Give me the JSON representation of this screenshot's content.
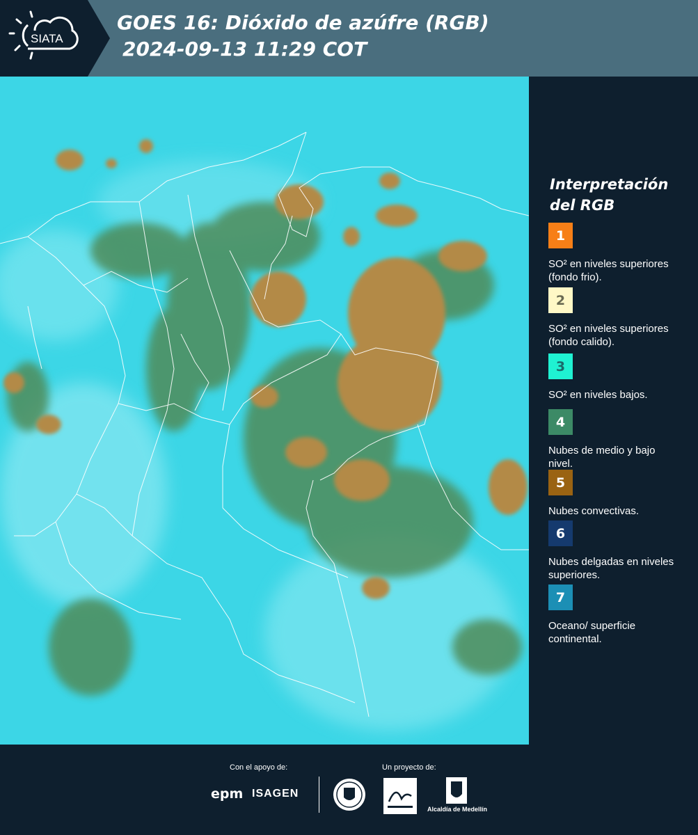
{
  "header": {
    "logo_text": "SIATA",
    "title_line1": "GOES 16: Dióxido de azúfre (RGB)",
    "title_line2": "2024-09-13 11:29 COT"
  },
  "legend": {
    "title_line1": "Interpretación",
    "title_line2": "del RGB",
    "items": [
      {
        "num": "1",
        "color": "#f77f17",
        "num_color": "#ffffff",
        "text": "SO² en niveles superiores (fondo frio)."
      },
      {
        "num": "2",
        "color": "#fff8c6",
        "num_color": "#6a6a52",
        "text": "SO² en niveles superiores (fondo calido)."
      },
      {
        "num": "3",
        "color": "#1ff2d2",
        "num_color": "#1a6a6a",
        "text": "SO² en niveles bajos."
      },
      {
        "num": "4",
        "color": "#3c8a66",
        "num_color": "#ffffff",
        "text": "Nubes de medio y bajo nivel."
      },
      {
        "num": "5",
        "color": "#9a6312",
        "num_color": "#ffffff",
        "text": "Nubes convectivas."
      },
      {
        "num": "6",
        "color": "#153a6e",
        "num_color": "#ffffff",
        "text": "Nubes delgadas en niveles superiores."
      },
      {
        "num": "7",
        "color": "#1c8fb5",
        "num_color": "#ffffff",
        "text": "Oceano/ superficie continental."
      }
    ]
  },
  "footer": {
    "support_label": "Con el apoyo de:",
    "project_label": "Un proyecto de:",
    "epm": "epm",
    "isagen": "ISAGEN",
    "alcaldia": "Alcaldía de Medellín"
  },
  "map": {
    "ocean_color": "#3cd6e6",
    "convective_color": "#b38a47",
    "mid_cloud_color": "#4f8c5a"
  }
}
